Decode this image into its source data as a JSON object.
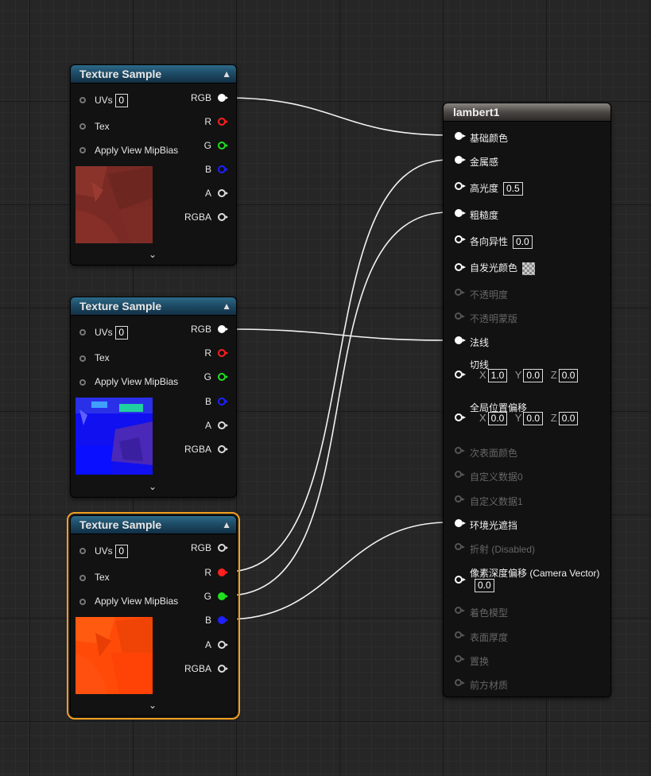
{
  "colors": {
    "accent_selected": "#f0a020",
    "header_blue": "#1e4c66",
    "pin_red": "#ff2020",
    "pin_green": "#20e020",
    "pin_blue": "#2020ff",
    "wire": "#ffffff"
  },
  "texture_nodes": [
    {
      "title": "Texture Sample",
      "inputs": {
        "uvs": "UVs",
        "uvs_value": "0",
        "tex": "Tex",
        "mip": "Apply View MipBias"
      },
      "outputs": {
        "rgb": "RGB",
        "r": "R",
        "g": "G",
        "b": "B",
        "a": "A",
        "rgba": "RGBA"
      },
      "preview": "reddish-brown texture"
    },
    {
      "title": "Texture Sample",
      "inputs": {
        "uvs": "UVs",
        "uvs_value": "0",
        "tex": "Tex",
        "mip": "Apply View MipBias"
      },
      "outputs": {
        "rgb": "RGB",
        "r": "R",
        "g": "G",
        "b": "B",
        "a": "A",
        "rgba": "RGBA"
      },
      "preview": "blue normal map"
    },
    {
      "title": "Texture Sample",
      "inputs": {
        "uvs": "UVs",
        "uvs_value": "0",
        "tex": "Tex",
        "mip": "Apply View MipBias"
      },
      "outputs": {
        "rgb": "RGB",
        "r": "R",
        "g": "G",
        "b": "B",
        "a": "A",
        "rgba": "RGBA"
      },
      "preview": "orange ORM texture",
      "selected": true
    }
  ],
  "material_node": {
    "title": "lambert1",
    "pins": {
      "base_color": "基础颜色",
      "metallic": "金属感",
      "specular": "高光度",
      "specular_value": "0.5",
      "roughness": "粗糙度",
      "anisotropy": "各向异性",
      "anisotropy_value": "0.0",
      "emissive": "自发光颜色",
      "opacity": "不透明度",
      "opacity_mask": "不透明蒙版",
      "normal": "法线",
      "tangent": "切线",
      "tangent_x": "1.0",
      "tangent_y": "0.0",
      "tangent_z": "0.0",
      "wpo": "全局位置偏移",
      "wpo_x": "0.0",
      "wpo_y": "0.0",
      "wpo_z": "0.0",
      "subsurface": "次表面颜色",
      "custom0": "自定义数据0",
      "custom1": "自定义数据1",
      "ao": "环境光遮挡",
      "refraction": "折射 (Disabled)",
      "pdo": "像素深度偏移 (Camera Vector)",
      "pdo_value": "0.0",
      "shading_model": "着色模型",
      "thickness": "表面厚度",
      "displacement": "置换",
      "front_material": "前方材质"
    },
    "axis": {
      "x": "X",
      "y": "Y",
      "z": "Z"
    }
  }
}
